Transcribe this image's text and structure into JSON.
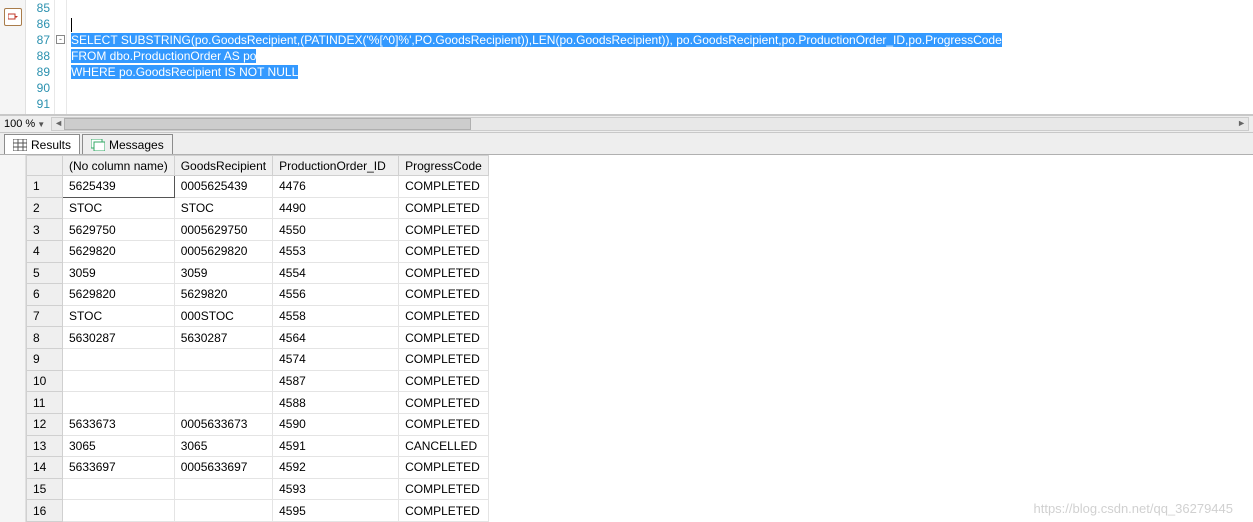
{
  "editor": {
    "lines_start": 85,
    "line_count": 7,
    "code85": "",
    "code86_cursor": true,
    "sql": {
      "select": "SELECT",
      "substring": "SUBSTRING",
      "patindex": "PATINDEX",
      "len": "LEN",
      "pattern": "'%[^0]%'",
      "from_kw": "FROM",
      "as_kw": "AS",
      "where_kw": "WHERE",
      "isnotnull": "IS NOT NULL",
      "po_goods": "po.GoodsRecipient",
      "PO_goods": "PO.GoodsRecipient",
      "po_id": "po.ProductionOrder_ID",
      "po_prog": "po.ProgressCode",
      "dbo_table": "dbo.ProductionOrder",
      "alias": "po"
    }
  },
  "zoom": {
    "value": "100 %"
  },
  "tabs": {
    "results": "Results",
    "messages": "Messages"
  },
  "grid": {
    "headers": {
      "nc": "(No column name)",
      "gr": "GoodsRecipient",
      "po": "ProductionOrder_ID",
      "pc": "ProgressCode"
    },
    "rows": [
      {
        "n": "1",
        "nc": "5625439",
        "gr": "0005625439",
        "po": "4476",
        "pc": "COMPLETED"
      },
      {
        "n": "2",
        "nc": "STOC",
        "gr": "STOC",
        "po": "4490",
        "pc": "COMPLETED"
      },
      {
        "n": "3",
        "nc": "5629750",
        "gr": "0005629750",
        "po": "4550",
        "pc": "COMPLETED"
      },
      {
        "n": "4",
        "nc": "5629820",
        "gr": "0005629820",
        "po": "4553",
        "pc": "COMPLETED"
      },
      {
        "n": "5",
        "nc": "3059",
        "gr": "3059",
        "po": "4554",
        "pc": "COMPLETED"
      },
      {
        "n": "6",
        "nc": "5629820",
        "gr": "5629820",
        "po": "4556",
        "pc": "COMPLETED"
      },
      {
        "n": "7",
        "nc": "STOC",
        "gr": "000STOC",
        "po": "4558",
        "pc": "COMPLETED"
      },
      {
        "n": "8",
        "nc": "5630287",
        "gr": "5630287",
        "po": "4564",
        "pc": "COMPLETED"
      },
      {
        "n": "9",
        "nc": "",
        "gr": "",
        "po": "4574",
        "pc": "COMPLETED"
      },
      {
        "n": "10",
        "nc": "",
        "gr": "",
        "po": "4587",
        "pc": "COMPLETED"
      },
      {
        "n": "11",
        "nc": "",
        "gr": "",
        "po": "4588",
        "pc": "COMPLETED"
      },
      {
        "n": "12",
        "nc": "5633673",
        "gr": "0005633673",
        "po": "4590",
        "pc": "COMPLETED"
      },
      {
        "n": "13",
        "nc": "3065",
        "gr": "3065",
        "po": "4591",
        "pc": "CANCELLED"
      },
      {
        "n": "14",
        "nc": "5633697",
        "gr": "0005633697",
        "po": "4592",
        "pc": "COMPLETED"
      },
      {
        "n": "15",
        "nc": "",
        "gr": "",
        "po": "4593",
        "pc": "COMPLETED"
      },
      {
        "n": "16",
        "nc": "",
        "gr": "",
        "po": "4595",
        "pc": "COMPLETED"
      }
    ]
  },
  "watermark": "https://blog.csdn.net/qq_36279445"
}
